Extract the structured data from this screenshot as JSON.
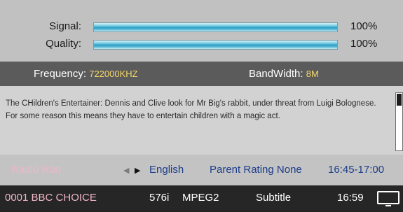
{
  "signal": {
    "signal_label": "Signal:",
    "signal_value": "100%",
    "signal_level": 1.0,
    "quality_label": "Quality:",
    "quality_value": "100%",
    "quality_level": 1.0
  },
  "tuning": {
    "frequency_label": "Frequency:",
    "frequency_value": "722000KHZ",
    "bandwidth_label": "BandWidth:",
    "bandwidth_value": "8M"
  },
  "epg": {
    "description": "The CHildren's Entertainer: Dennis and Clive look for Mr Big's rabbit, under threat from Luigi Bolognese. For some reason this means they have to entertain children with a magic act."
  },
  "program": {
    "radio_label": "Radio Roo",
    "arrow_left": "◀",
    "arrow_right": "▶",
    "audio_language": "English",
    "parent_rating": "Parent Rating None",
    "time_range": "16:45-17:00"
  },
  "channel": {
    "name": "0001 BBC CHOICE",
    "resolution": "576i",
    "codec": "MPEG2",
    "subtitle_label": "Subtitle",
    "clock": "16:59",
    "icon": "tv-icon"
  },
  "colors": {
    "channel_name": "#f1b6c8",
    "info_text": "#1b3c8a",
    "frequency_value": "#f5d96b",
    "channel_bar_bg": "#262626"
  }
}
